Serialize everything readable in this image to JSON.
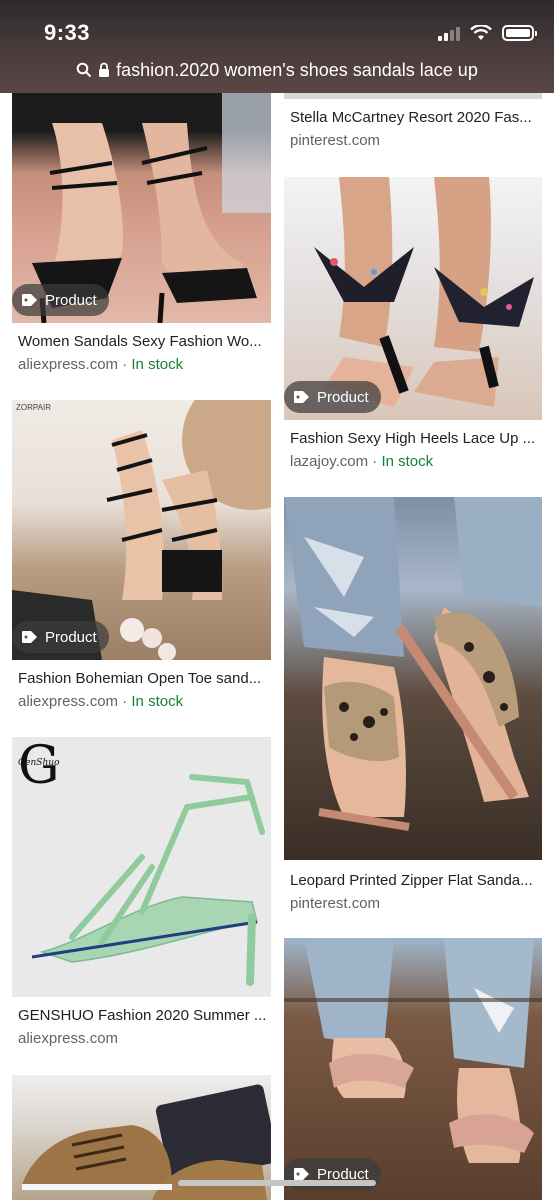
{
  "status_bar": {
    "time": "9:33"
  },
  "address_bar": {
    "url_text": "fashion.2020 women's shoes sandals lace up",
    "search_icon": "search-icon",
    "lock_icon": "lock-icon"
  },
  "badge_label": "Product",
  "colors": {
    "in_stock": "#188038",
    "source": "#5f6368",
    "title": "#202124",
    "badge_bg": "#3c3c3c"
  },
  "left_column": [
    {
      "title": "Women Sandals Sexy Fashion Wo...",
      "source": "aliexpress.com",
      "sep": " · ",
      "stock": "In stock",
      "badge": true
    },
    {
      "title": "Fashion Bohemian Open Toe sand...",
      "source": "aliexpress.com",
      "sep": " · ",
      "stock": "In stock",
      "badge": true,
      "brand_mark": "ZORPAIR"
    },
    {
      "title": "GENSHUO Fashion 2020 Summer ...",
      "source": "aliexpress.com",
      "badge": false,
      "logo_text": "GenShuo"
    },
    {
      "title": "",
      "source": "",
      "badge": false
    }
  ],
  "right_column": [
    {
      "title": "Stella McCartney Resort 2020 Fas...",
      "source": "pinterest.com"
    },
    {
      "title": "Fashion Sexy High Heels Lace Up ...",
      "source": "lazajoy.com",
      "sep": " · ",
      "stock": "In stock",
      "badge": true
    },
    {
      "title": "Leopard Printed Zipper Flat Sanda...",
      "source": "pinterest.com",
      "badge": false
    },
    {
      "title": "",
      "source": "",
      "badge": true
    }
  ]
}
